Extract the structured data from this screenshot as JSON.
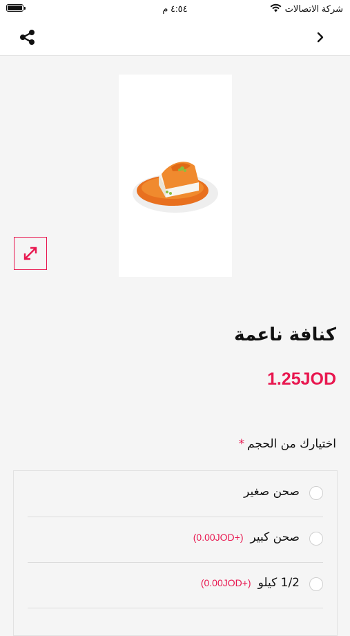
{
  "status_bar": {
    "time": "٤:٥٤ م",
    "carrier": "شركة الاتصالات"
  },
  "nav": {
    "share_icon": "share-icon",
    "back_icon": "chevron-right-icon"
  },
  "product": {
    "image_alt": "kunafa-dessert-image",
    "title": "كنافة ناعمة",
    "price": "1.25JOD"
  },
  "options": {
    "label": "اختيارك من الحجم",
    "required_mark": "*",
    "items": [
      {
        "label": "صحن صغير",
        "extra": ""
      },
      {
        "label": "صحن كبير",
        "extra": "(+0.00JOD)"
      },
      {
        "label": "1/2 كيلو",
        "extra": "(+0.00JOD)"
      }
    ]
  },
  "colors": {
    "accent": "#e8174f",
    "background": "#f5f5f5",
    "surface": "#ffffff"
  }
}
